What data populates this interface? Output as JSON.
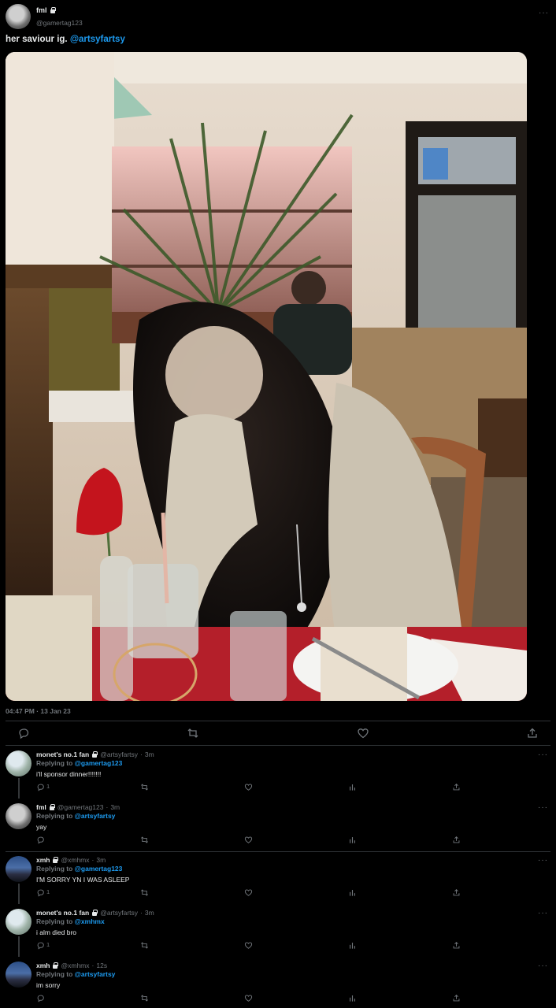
{
  "tweet": {
    "author_name": "fml",
    "author_handle": "@gamertag123",
    "text_prefix": "her saviour ig. ",
    "text_mention": "@artsyfartsy",
    "timestamp": "04:47 PM · 13 Jan 23",
    "more_label": "···",
    "actions": [
      "reply-icon",
      "retweet-icon",
      "like-icon",
      "share-icon"
    ]
  },
  "replies": [
    {
      "name": "monet's no.1 fan",
      "handle": "@artsyfartsy",
      "time": "3m",
      "replying_label": "Replying to ",
      "replying_to": "@gamertag123",
      "body": "i'll sponsor dinner!!!!!!!",
      "reply_count": "1",
      "avatar": "sky",
      "thread": true
    },
    {
      "name": "fml",
      "handle": "@gamertag123",
      "time": "3m",
      "replying_label": "Replying to ",
      "replying_to": "@artsyfartsy",
      "body": "yay",
      "reply_count": "",
      "avatar": "cat",
      "thread": false
    },
    {
      "name": "xmh",
      "handle": "@xmhmx",
      "time": "3m",
      "replying_label": "Replying to ",
      "replying_to": "@gamertag123",
      "body": "I'M SORRY YN I WAS ASLEEP",
      "reply_count": "1",
      "avatar": "dusk",
      "thread": true
    },
    {
      "name": "monet's no.1 fan",
      "handle": "@artsyfartsy",
      "time": "3m",
      "replying_label": "Replying to ",
      "replying_to": "@xmhmx",
      "body": "i alm died bro",
      "reply_count": "1",
      "avatar": "sky",
      "thread": true
    },
    {
      "name": "xmh",
      "handle": "@xmhmx",
      "time": "12s",
      "replying_label": "Replying to ",
      "replying_to": "@artsyfartsy",
      "body": "im sorry",
      "reply_count": "",
      "avatar": "dusk",
      "thread": false
    }
  ],
  "colors": {
    "background": "#000000",
    "text": "#e7e9ea",
    "secondary": "#71767b",
    "link": "#1d9bf0",
    "divider": "#2f3336"
  }
}
